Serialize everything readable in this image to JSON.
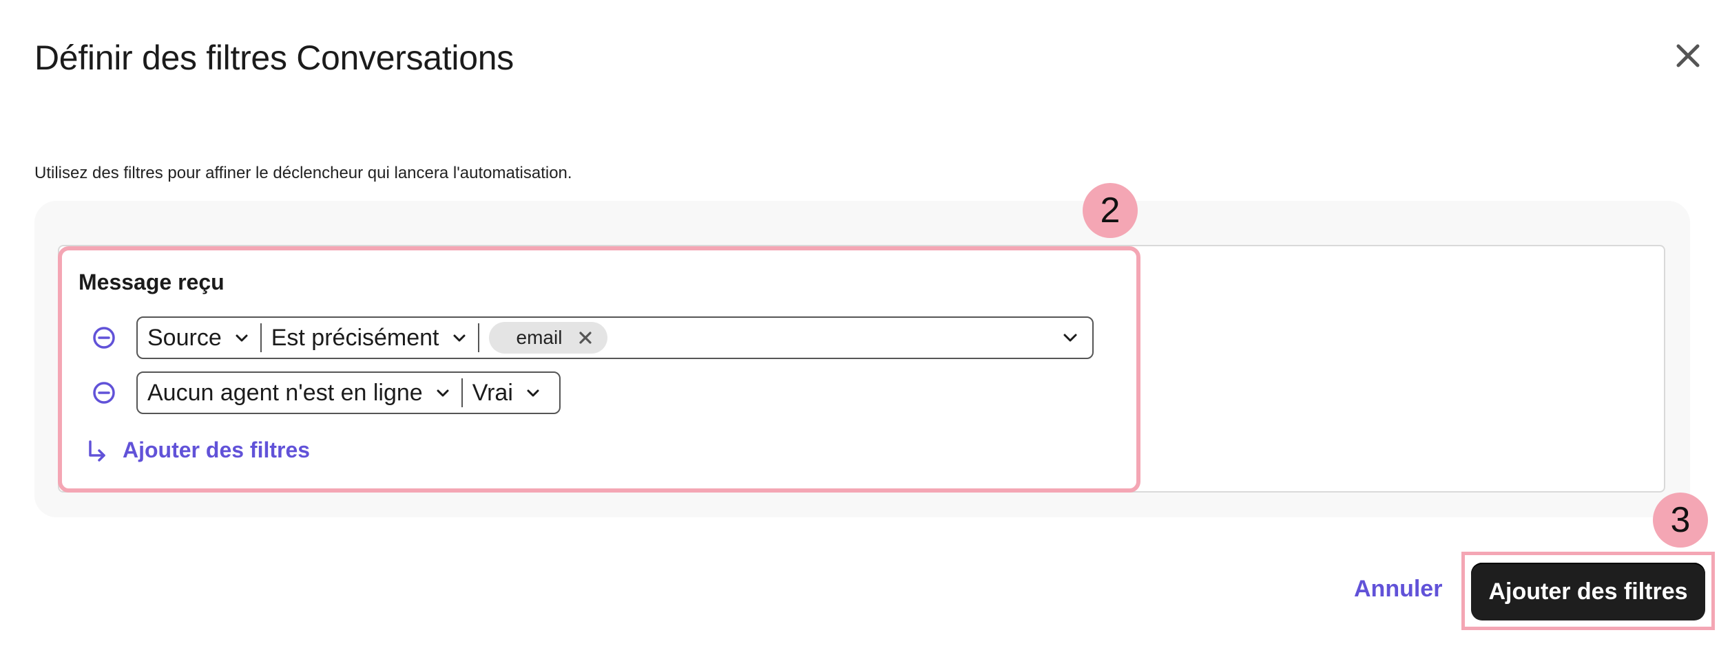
{
  "dialog": {
    "title": "Définir des filtres Conversations",
    "subtitle": "Utilisez des filtres pour affiner le déclencheur qui lancera l'automatisation."
  },
  "group": {
    "title": "Message reçu",
    "rows": [
      {
        "field": "Source",
        "operator": "Est précisément",
        "values": [
          "email"
        ]
      },
      {
        "field": "Aucun agent n'est en ligne",
        "operator": "Vrai"
      }
    ],
    "add_filter_label": "Ajouter des filtres"
  },
  "annotations": {
    "group_badge": "2",
    "submit_badge": "3"
  },
  "footer": {
    "cancel_label": "Annuler",
    "submit_label": "Ajouter des filtres"
  },
  "icons": {
    "close": "close-icon",
    "remove": "minus-circle-icon",
    "chevron": "chevron-down-icon",
    "chip_remove": "x-icon",
    "add": "arrow-return-right-icon"
  },
  "colors": {
    "accent": "#6152d8",
    "highlight": "#f4a6b4",
    "primary_button": "#1e1e1e",
    "panel_bg": "#f8f8f8"
  }
}
